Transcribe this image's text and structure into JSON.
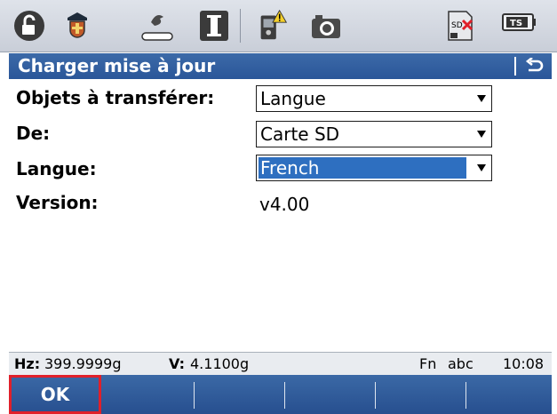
{
  "toolbar": {
    "icons": [
      "unlock-icon",
      "shield-icon",
      "level-bubble-icon",
      "text-cursor-icon",
      "instrument-warning-icon",
      "camera-icon",
      "sd-card-error-icon",
      "battery-ts-icon"
    ],
    "battery_label": "TS",
    "sd_label": "SD"
  },
  "titlebar": {
    "title": "Charger mise à jour"
  },
  "form": {
    "objects_label": "Objets à transférer:",
    "objects_value": "Langue",
    "from_label": "De:",
    "from_value": "Carte SD",
    "language_label": "Langue:",
    "language_value": "French",
    "version_label": "Version:",
    "version_value": "v4.00"
  },
  "status": {
    "hz_label": "Hz:",
    "hz_value": "399.9999g",
    "v_label": "V:",
    "v_value": "4.1100g",
    "fn_mode": "Fn",
    "input_mode": "abc",
    "time": "10:08"
  },
  "softkeys": {
    "f1": "OK",
    "f2": "",
    "f3": "",
    "f4": "",
    "f5": "",
    "f6": ""
  },
  "colors": {
    "accent": "#2a5699",
    "selection": "#2e6fc0",
    "highlight": "#e0202a"
  }
}
